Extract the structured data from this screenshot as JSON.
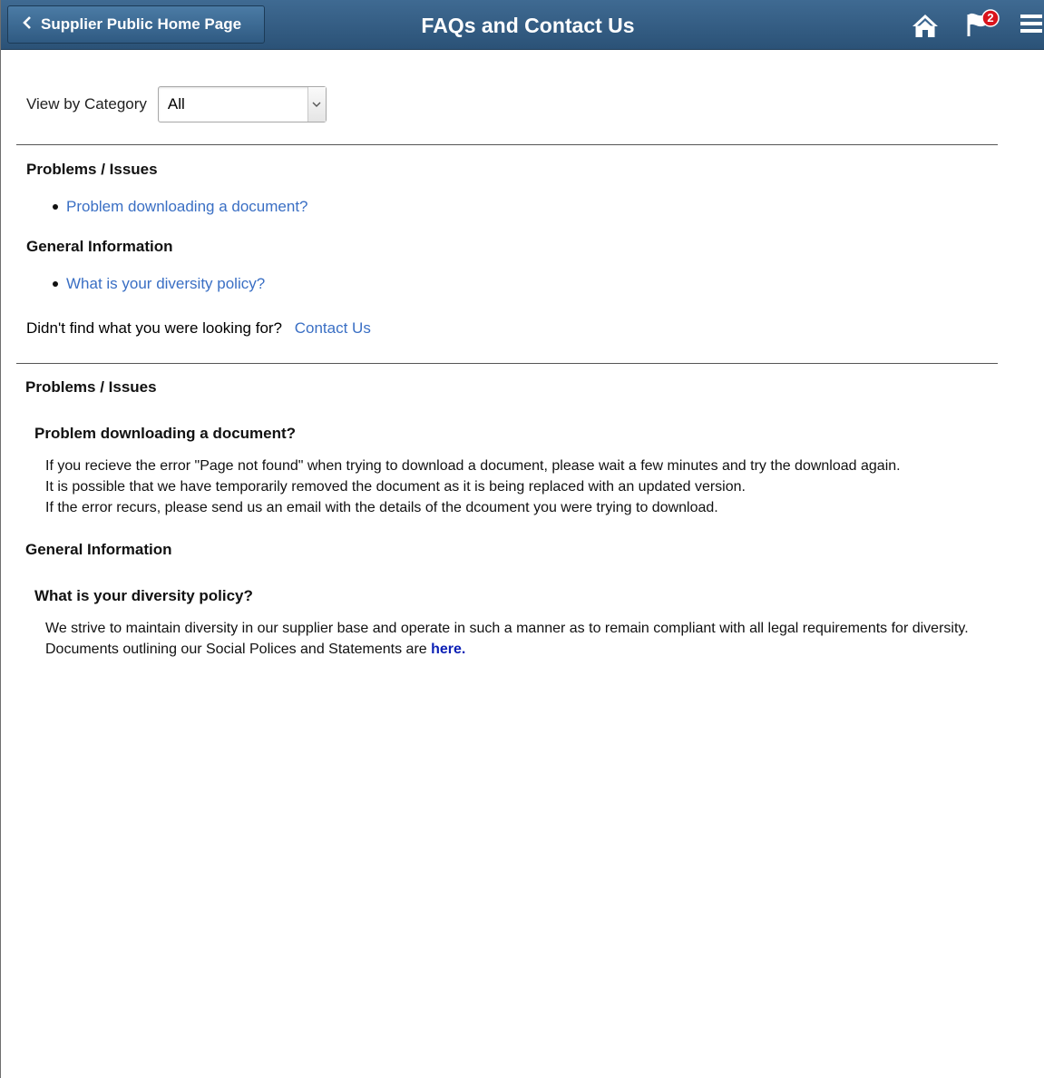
{
  "header": {
    "back_label": "Supplier Public Home Page",
    "title": "FAQs and Contact Us",
    "notification_count": "2",
    "icons": {
      "back": "chevron-left-icon",
      "home": "home-icon",
      "notifications": "flag-icon",
      "menu": "hamburger-menu-icon"
    },
    "colors": {
      "bar": "#2f5a82",
      "badge": "#d9141c"
    }
  },
  "filter": {
    "label": "View by Category",
    "selected": "All"
  },
  "index": {
    "categories": [
      {
        "heading": "Problems / Issues",
        "questions": [
          "Problem downloading a document?"
        ]
      },
      {
        "heading": "General Information",
        "questions": [
          "What is your diversity policy?"
        ]
      }
    ],
    "not_found_text": "Didn't find what you were looking for?",
    "contact_link": "Contact Us"
  },
  "details": [
    {
      "category": "Problems / Issues",
      "question": "Problem downloading a document?",
      "answer_lines": [
        "If you recieve the error \"Page not found\" when trying to download a document, please wait a few minutes and try the download again.",
        "It is possible that we have temporarily removed the document as it is being replaced with an updated version.",
        "If the error recurs, please send us an email with the details of the dcoument you were trying to download."
      ]
    },
    {
      "category": "General Information",
      "question": "What is your diversity policy?",
      "answer_text": "We strive to maintain diversity in our supplier base and operate in such a manner as to remain compliant with all legal requirements for diversity. Documents outlining our Social Polices and Statements are",
      "answer_link": "here."
    }
  ],
  "colors": {
    "link": "#3a6fc4",
    "strong_link": "#0b1fb5"
  }
}
